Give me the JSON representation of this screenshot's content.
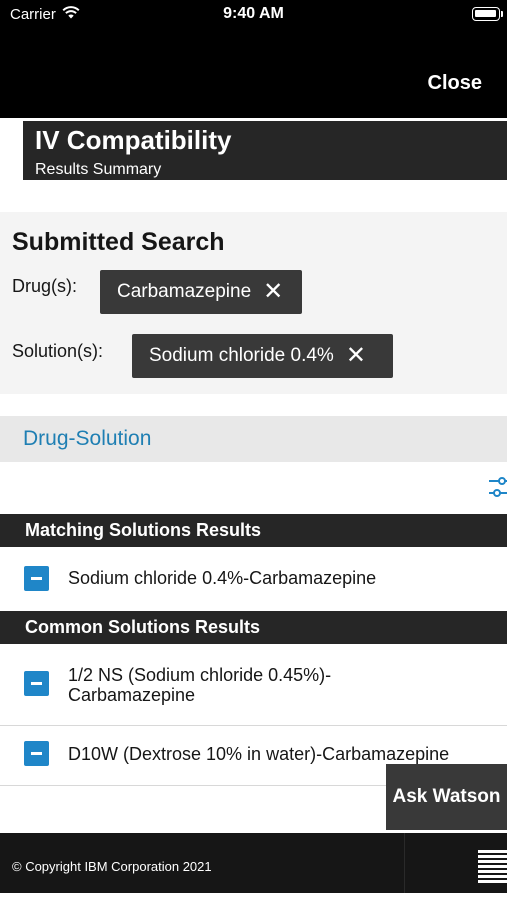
{
  "status_bar": {
    "carrier": "Carrier",
    "time": "9:40 AM"
  },
  "nav": {
    "close_label": "Close"
  },
  "header": {
    "title": "IV Compatibility",
    "subtitle": "Results Summary"
  },
  "submitted_search": {
    "heading": "Submitted Search",
    "drugs_label": "Drug(s):",
    "drugs": [
      "Carbamazepine"
    ],
    "solutions_label": "Solution(s):",
    "solutions": [
      "Sodium chloride 0.4%"
    ],
    "remove_glyph": "✕"
  },
  "tab": {
    "label": "Drug-Solution"
  },
  "matching": {
    "header": "Matching Solutions Results",
    "items": [
      "Sodium chloride 0.4%-Carbamazepine"
    ]
  },
  "common": {
    "header": "Common Solutions Results",
    "items": [
      [
        "1/2 NS (Sodium chloride 0.45%)-",
        "Carbamazepine"
      ],
      [
        "D10W (Dextrose 10% in water)-Carbamazepine"
      ]
    ]
  },
  "ask_watson": {
    "label": "Ask Watson"
  },
  "footer": {
    "copyright": "© Copyright IBM Corporation 2021",
    "logo_text": "IBM"
  },
  "colors": {
    "accent": "#1f86c8",
    "tab_text": "#1f7fb3",
    "dark_panel": "#262626",
    "chip": "#393939"
  },
  "icons": [
    "wifi-icon",
    "battery-icon",
    "close-x-icon",
    "filter-sliders-icon",
    "collapse-minus-icon",
    "ibm-logo"
  ]
}
